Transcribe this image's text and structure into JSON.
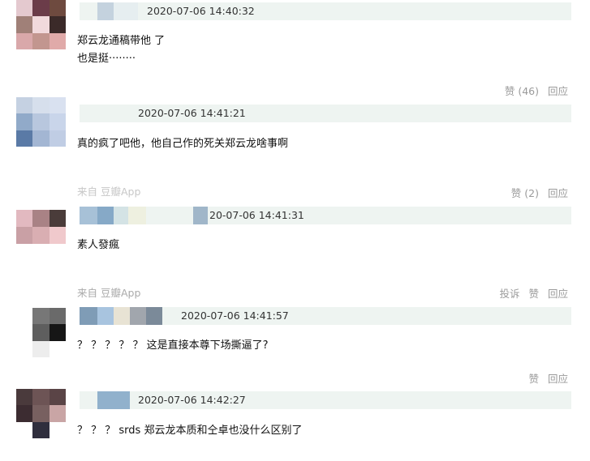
{
  "comments": [
    {
      "timestamp": "2020-07-06 14:40:32",
      "text": "郑云龙通稿带他 了\n也是挺········",
      "actions": {
        "like": "赞 (46)",
        "reply": "回应"
      }
    },
    {
      "timestamp": "2020-07-06 14:41:21",
      "text": "真的疯了吧他，他自己作的死关郑云龙啥事啊",
      "source": "来自 豆瓣App",
      "actions": {
        "like": "赞 (2)",
        "reply": "回应"
      }
    },
    {
      "timestamp": "20-07-06 14:41:31",
      "text": "素人發瘋",
      "source": "来自 豆瓣App",
      "actions": {
        "report": "投诉",
        "like": "赞",
        "reply": "回应"
      }
    },
    {
      "timestamp": "2020-07-06 14:41:57",
      "text": "？ ？ ？ ？ ？ 这是直接本尊下场撕逼了?",
      "actions": {
        "like": "赞",
        "reply": "回应"
      }
    },
    {
      "timestamp": "2020-07-06 14:42:27",
      "text": "？ ？ ？ srds 郑云龙本质和仝卓也没什么区别了"
    }
  ],
  "avatar_colors": [
    [
      "#e4c9cf",
      "#6b3c49",
      "#6e4a3f",
      "#a08078",
      "#f1d9dc",
      "#3b2a29",
      "#d9a8aa",
      "#c2968f",
      "#e0aaa9"
    ],
    [
      "#c5d1e2",
      "#d6dfec",
      "#d9e1f0",
      "#91aac9",
      "#b8c7de",
      "#c9d5ea",
      "#5a7aa6",
      "#a3b6d3",
      "#c0cde4"
    ],
    [
      "#e2b9c0",
      "#a98285",
      "#4a3c3a",
      "#c9a0a5",
      "#d9aeb2",
      "#f0c9cc",
      "#c4969c",
      "#d4a3a8",
      "#ebc0c4"
    ],
    [
      "#ffffff",
      "#777777",
      "#6a6a6a",
      "#ffffff",
      "#5e5e5e",
      "#161616",
      "#ffffff",
      "#ededed",
      "#ffffff"
    ],
    [
      "#4a3a3c",
      "#6d5455",
      "#5a4446",
      "#3c2c31",
      "#786060",
      "#c9a5a5",
      "#ffffff",
      "#2f2e3d",
      "#ffffff"
    ]
  ]
}
